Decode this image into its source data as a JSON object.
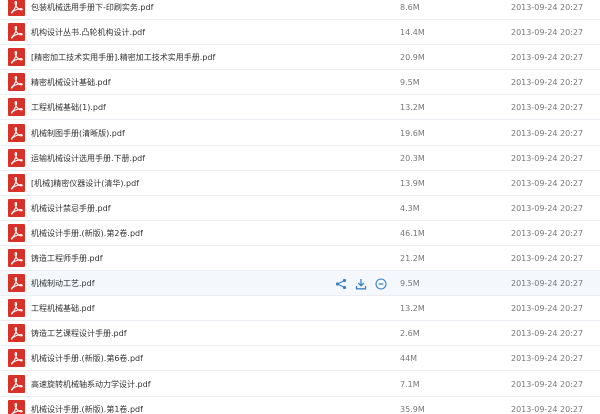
{
  "files": [
    {
      "name": "包装机械选用手册下-印刷实务.pdf",
      "size": "8.6M",
      "date": "2013-09-24 20:27"
    },
    {
      "name": "机构设计丛书.凸轮机构设计.pdf",
      "size": "14.4M",
      "date": "2013-09-24 20:27"
    },
    {
      "name": "[精密加工技术实用手册].精密加工技术实用手册.pdf",
      "size": "20.9M",
      "date": "2013-09-24 20:27"
    },
    {
      "name": "精密机械设计基础.pdf",
      "size": "9.5M",
      "date": "2013-09-24 20:27"
    },
    {
      "name": "工程机械基础(1).pdf",
      "size": "13.2M",
      "date": "2013-09-24 20:27"
    },
    {
      "name": "机械制图手册(清晰版).pdf",
      "size": "19.6M",
      "date": "2013-09-24 20:27"
    },
    {
      "name": "运输机械设计选用手册.下册.pdf",
      "size": "20.3M",
      "date": "2013-09-24 20:27"
    },
    {
      "name": "[机械]精密仪器设计(清华).pdf",
      "size": "13.9M",
      "date": "2013-09-24 20:27"
    },
    {
      "name": "机械设计禁忌手册.pdf",
      "size": "4.3M",
      "date": "2013-09-24 20:27"
    },
    {
      "name": "机械设计手册.(新版).第2卷.pdf",
      "size": "46.1M",
      "date": "2013-09-24 20:27"
    },
    {
      "name": "铸造工程师手册.pdf",
      "size": "21.2M",
      "date": "2013-09-24 20:27"
    },
    {
      "name": "机械制动工艺.pdf",
      "size": "9.5M",
      "date": "2013-09-24 20:27",
      "hovered": true
    },
    {
      "name": "工程机械基础.pdf",
      "size": "13.2M",
      "date": "2013-09-24 20:27"
    },
    {
      "name": "铸造工艺课程设计手册.pdf",
      "size": "2.6M",
      "date": "2013-09-24 20:27"
    },
    {
      "name": "机械设计手册.(新版).第6卷.pdf",
      "size": "44M",
      "date": "2013-09-24 20:27"
    },
    {
      "name": "高速旋转机械轴系动力学设计.pdf",
      "size": "7.1M",
      "date": "2013-09-24 20:27"
    },
    {
      "name": "机械设计手册.(新版).第1卷.pdf",
      "size": "35.9M",
      "date": "2013-09-24 20:27"
    }
  ],
  "colors": {
    "pdf_icon": "#d6322a",
    "hover_row": "#f4f8fd",
    "action_icon": "#3b82c4",
    "divider": "#ebedf2"
  },
  "icons": {
    "file": "pdf-icon",
    "actions": [
      "share-icon",
      "download-icon",
      "more-icon"
    ]
  }
}
